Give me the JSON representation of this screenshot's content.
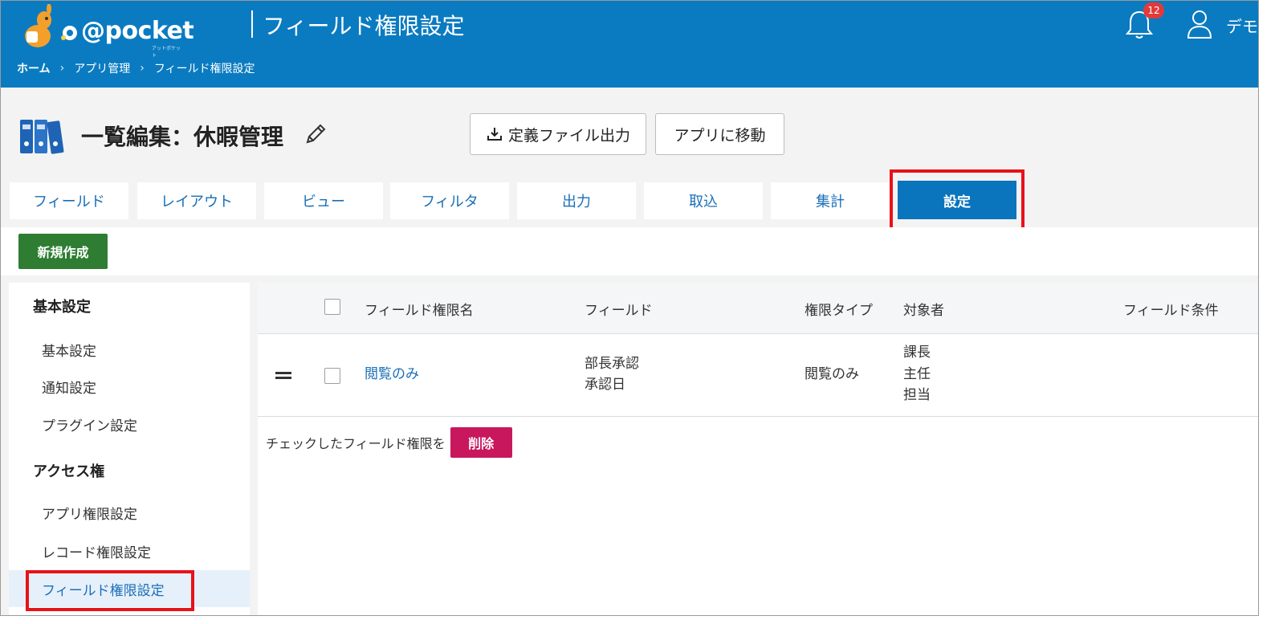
{
  "header": {
    "logo_text": "@pocket",
    "logo_sub": "アットポケット",
    "page_title": "フィールド権限設定",
    "notification_count": "12",
    "user_name": "デモ"
  },
  "breadcrumb": [
    "ホーム",
    "アプリ管理",
    "フィールド権限設定"
  ],
  "app": {
    "title": "一覧編集：休暇管理",
    "export_label": "定義ファイル出力",
    "goto_label": "アプリに移動"
  },
  "tabs": [
    {
      "label": "フィールド"
    },
    {
      "label": "レイアウト"
    },
    {
      "label": "ビュー"
    },
    {
      "label": "フィルタ"
    },
    {
      "label": "出力"
    },
    {
      "label": "取込"
    },
    {
      "label": "集計"
    },
    {
      "label": "設定",
      "active": true
    }
  ],
  "toolbar": {
    "new_label": "新規作成"
  },
  "sidebar": {
    "section1": "基本設定",
    "section1_items": [
      "基本設定",
      "通知設定",
      "プラグイン設定"
    ],
    "section2": "アクセス権",
    "section2_items": [
      "アプリ権限設定",
      "レコード権限設定",
      "フィールド権限設定"
    ]
  },
  "table": {
    "headers": {
      "name": "フィールド権限名",
      "field": "フィールド",
      "type": "権限タイプ",
      "target": "対象者",
      "condition": "フィールド条件"
    },
    "rows": [
      {
        "name": "閲覧のみ",
        "fields": [
          "部長承認",
          "承認日"
        ],
        "type": "閲覧のみ",
        "targets": [
          "課長",
          "主任",
          "担当"
        ],
        "condition": ""
      }
    ]
  },
  "footer": {
    "prompt": "チェックしたフィールド権限を",
    "delete_label": "削除"
  },
  "colors": {
    "header_bg": "#0a7bc1",
    "active_tab": "#0a74bd",
    "new_button": "#2e7d32",
    "delete_button": "#c8175d",
    "highlight": "#e8121a"
  }
}
